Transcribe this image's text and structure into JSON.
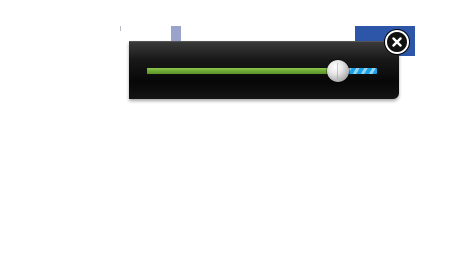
{
  "popup": {
    "slider": {
      "value_fraction": 0.83,
      "fill_color": "#6ea834",
      "track_color": "#1aa0e6"
    },
    "close_icon": "close-icon"
  },
  "colors": {
    "background": "#ffffff",
    "popup_background": "#0d0d0d",
    "accent_blue": "#2d55a8"
  }
}
